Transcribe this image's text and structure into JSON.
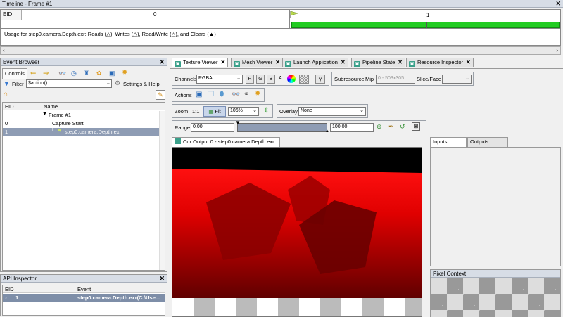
{
  "timeline": {
    "title": "Timeline - Frame #1",
    "eid_label": "EID:",
    "tick_0": "0",
    "tick_1": "1",
    "usage_text": "Usage for step0.camera.Depth.exr: Reads (△), Writes (△), Read/Write (△), and Clears (▲)"
  },
  "event_browser": {
    "title": "Event Browser",
    "controls_label": "Controls",
    "filter_label": "Filter",
    "filter_value": "$action()",
    "settings_label": "Settings & Help",
    "col_eid": "EID",
    "col_name": "Name",
    "rows": [
      {
        "eid": "",
        "name": "Frame #1"
      },
      {
        "eid": "0",
        "name": "Capture Start"
      },
      {
        "eid": "1",
        "name": "step0.camera.Depth.exr"
      }
    ]
  },
  "api_inspector": {
    "title": "API Inspector",
    "col_eid": "EID",
    "col_event": "Event",
    "row_eid": "1",
    "row_event": "step0.camera.Depth.exr(C:\\Use..."
  },
  "tabs": [
    "Texture Viewer",
    "Mesh Viewer",
    "Launch Application",
    "Pipeline State",
    "Resource Inspector"
  ],
  "texture_viewer": {
    "channels_label": "Channels",
    "channels_value": "RGBA",
    "r": "R",
    "g": "G",
    "b": "B",
    "a": "A",
    "gamma": "γ",
    "subresource_label": "Subresource",
    "mip_label": "Mip",
    "mip_value": "0 - 503x305",
    "slice_label": "Slice/Face",
    "actions_label": "Actions",
    "zoom_label": "Zoom",
    "zoom_11": "1:1",
    "fit_label": "Fit",
    "zoom_value": "106%",
    "overlay_label": "Overlay",
    "overlay_value": "None",
    "range_label": "Range",
    "range_min": "0.00",
    "range_max": "100.00",
    "output_tab": "Cur Output 0 - step0.camera.Depth.exr",
    "inputs_tab": "Inputs",
    "outputs_tab": "Outputs",
    "pixel_context": "Pixel Context"
  },
  "colors": {
    "timeline_green": "#22cc22",
    "selected_row": "#8e9cb4",
    "depth_red": "#ff0000"
  }
}
